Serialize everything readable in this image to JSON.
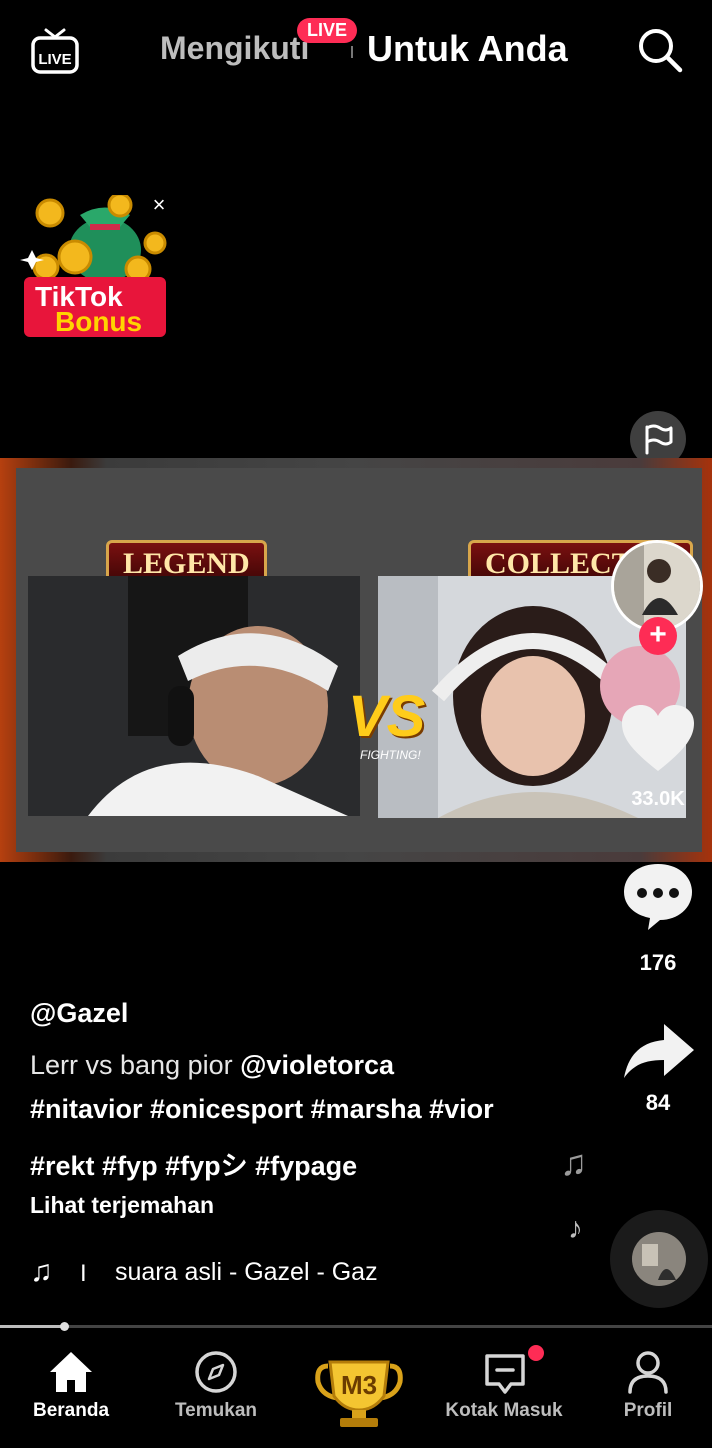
{
  "header": {
    "tab_following": "Mengikuti",
    "live_badge": "LIVE",
    "tab_foryou": "Untuk Anda"
  },
  "bonus": {
    "line1": "TikTok",
    "line2": "Bonus",
    "close": "×"
  },
  "video": {
    "left_banner": "LEGEND",
    "right_banner": "COLLECTOR",
    "vs": "VS",
    "vs_sub": "FIGHTING!"
  },
  "actions": {
    "like_count": "33.0K",
    "comment_count": "176",
    "share_count": "84",
    "follow_plus": "+"
  },
  "caption": {
    "username": "@Gazel",
    "line1_text": "Lerr vs bang pior ",
    "line1_mention": "@violetorca",
    "line2": "#nitavior #onicesport #marsha #vior",
    "line3": "#rekt #fyp #fypシ  #fypage",
    "translate": "Lihat terjemahan",
    "sound_sep": "I",
    "sound_title": "suara asli - Gazel - Gaz"
  },
  "nav": {
    "home": "Beranda",
    "discover": "Temukan",
    "center_badge": "M3",
    "inbox": "Kotak Masuk",
    "profile": "Profil"
  },
  "progress": 0.09,
  "colors": {
    "accent": "#fe2c55",
    "gold": "#ffcc1a"
  }
}
